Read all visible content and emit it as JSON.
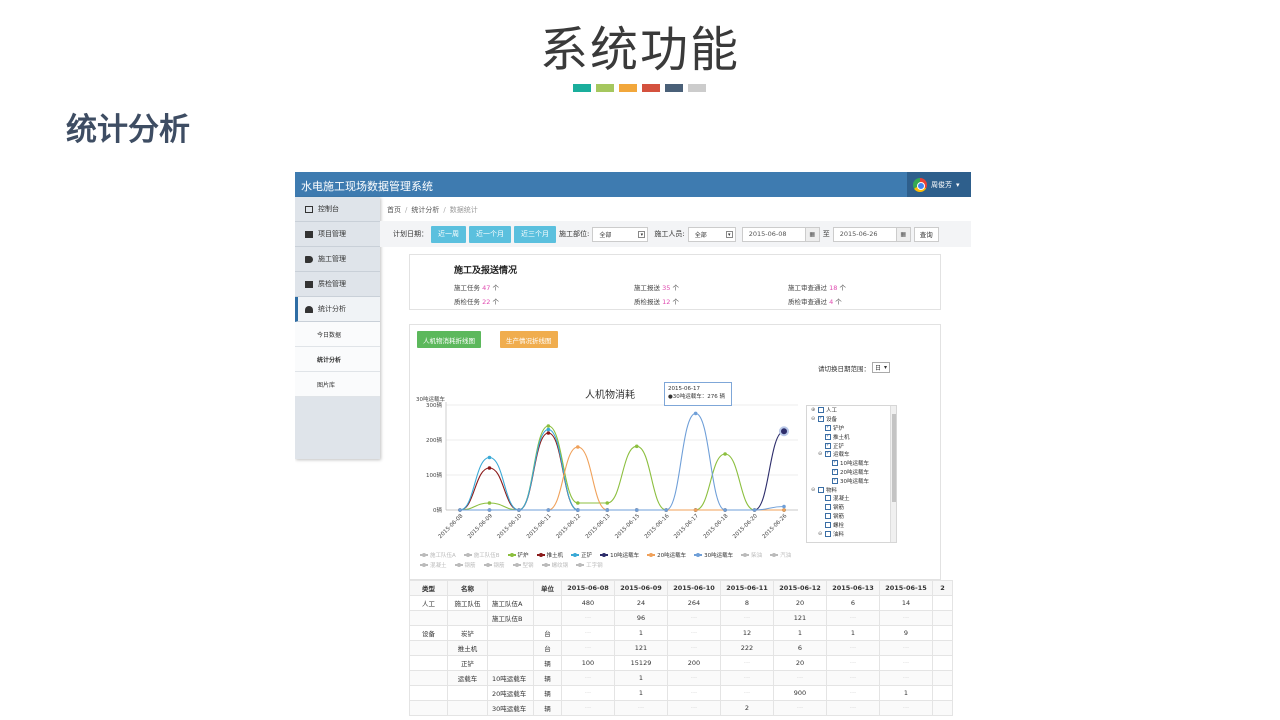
{
  "slide": {
    "title": "系统功能",
    "section": "统计分析",
    "strip_colors": [
      "#1aae9c",
      "#a5c75e",
      "#f2a73b",
      "#d4513e",
      "#4a6078",
      "#cccccc"
    ]
  },
  "app": {
    "title": "水电施工现场数据管理系统",
    "user": "周俊芳"
  },
  "sidebar": {
    "items": [
      {
        "label": "控制台",
        "icon": "monitor-icon"
      },
      {
        "label": "项目管理",
        "icon": "binoculars-icon"
      },
      {
        "label": "施工管理",
        "icon": "tag-icon"
      },
      {
        "label": "质检管理",
        "icon": "folder-icon"
      },
      {
        "label": "统计分析",
        "icon": "dashboard-icon"
      }
    ],
    "sub_items": [
      {
        "label": "今日数据"
      },
      {
        "label": "统计分析"
      },
      {
        "label": "图片库"
      }
    ]
  },
  "breadcrumb": {
    "home": "首页",
    "parent": "统计分析",
    "current": "数据统计"
  },
  "filter": {
    "plan_date_label": "计划日期：",
    "btn_week": "近一周",
    "btn_month": "近一个月",
    "btn_quarter": "近三个月",
    "dept_label": "施工部位:",
    "dept_value": "全部",
    "staff_label": "施工人员:",
    "staff_value": "全部",
    "date_from": "2015-06-08",
    "to_label": "至",
    "date_to": "2015-06-26",
    "query_btn": "查询"
  },
  "summary": {
    "title": "施工及报送情况",
    "stats": [
      {
        "label": "施工任务",
        "value": "47",
        "unit": "个"
      },
      {
        "label": "施工报送",
        "value": "35",
        "unit": "个"
      },
      {
        "label": "施工审查通过",
        "value": "18",
        "unit": "个"
      },
      {
        "label": "质检任务",
        "value": "22",
        "unit": "个"
      },
      {
        "label": "质检报送",
        "value": "12",
        "unit": "个"
      },
      {
        "label": "质检审查通过",
        "value": "4",
        "unit": "个"
      }
    ]
  },
  "chart_panel": {
    "tab1": "人机物消耗折线图",
    "tab2": "生产情况折线图",
    "range_label": "请切换日期范围：",
    "range_value": "日",
    "tooltip_date": "2015-06-17",
    "tooltip_text": "●30吨运载车：276 辆",
    "tree": [
      {
        "label": "人工",
        "level": 0,
        "toggle": "⊕",
        "checked": false
      },
      {
        "label": "设备",
        "level": 0,
        "toggle": "⊖",
        "checked": true
      },
      {
        "label": "铲炉",
        "level": 1,
        "toggle": "",
        "checked": true
      },
      {
        "label": "推土机",
        "level": 1,
        "toggle": "",
        "checked": true
      },
      {
        "label": "正铲",
        "level": 1,
        "toggle": "",
        "checked": true
      },
      {
        "label": "运载车",
        "level": 1,
        "toggle": "⊖",
        "checked": true
      },
      {
        "label": "10吨运载车",
        "level": 2,
        "toggle": "",
        "checked": true
      },
      {
        "label": "20吨运载车",
        "level": 2,
        "toggle": "",
        "checked": true
      },
      {
        "label": "30吨运载车",
        "level": 2,
        "toggle": "",
        "checked": true
      },
      {
        "label": "物料",
        "level": 0,
        "toggle": "⊖",
        "checked": false
      },
      {
        "label": "混凝土",
        "level": 1,
        "toggle": "",
        "checked": false
      },
      {
        "label": "钢筋",
        "level": 1,
        "toggle": "",
        "checked": false
      },
      {
        "label": "钢筋",
        "level": 1,
        "toggle": "",
        "checked": false
      },
      {
        "label": "螺栓",
        "level": 1,
        "toggle": "",
        "checked": false
      },
      {
        "label": "油料",
        "level": 1,
        "toggle": "⊖",
        "checked": false
      }
    ],
    "legend": [
      {
        "name": "施工队伍A",
        "color": "#bbbbbb",
        "on": false
      },
      {
        "name": "施工队伍B",
        "color": "#bbbbbb",
        "on": false
      },
      {
        "name": "铲炉",
        "color": "#8cbf3f",
        "on": true
      },
      {
        "name": "推土机",
        "color": "#8b1a1a",
        "on": true
      },
      {
        "name": "正铲",
        "color": "#3aa9d6",
        "on": true
      },
      {
        "name": "10吨运载车",
        "color": "#2d2d6b",
        "on": true
      },
      {
        "name": "20吨运载车",
        "color": "#f0a15a",
        "on": true
      },
      {
        "name": "30吨运载车",
        "color": "#6f9fd8",
        "on": true
      },
      {
        "name": "柴油",
        "color": "#bbbbbb",
        "on": false
      },
      {
        "name": "汽油",
        "color": "#bbbbbb",
        "on": false
      },
      {
        "name": "混凝土",
        "color": "#bbbbbb",
        "on": false
      },
      {
        "name": "钢筋",
        "color": "#bbbbbb",
        "on": false
      },
      {
        "name": "钢筋",
        "color": "#bbbbbb",
        "on": false
      },
      {
        "name": "型钢",
        "color": "#bbbbbb",
        "on": false
      },
      {
        "name": "螺纹钢",
        "color": "#bbbbbb",
        "on": false
      },
      {
        "name": "工字钢",
        "color": "#bbbbbb",
        "on": false
      }
    ]
  },
  "chart_data": {
    "type": "line",
    "title": "人机物消耗",
    "ylabel": "30吨运载车",
    "y_ticks": [
      "0辆",
      "100辆",
      "200辆",
      "300辆"
    ],
    "ylim": [
      0,
      300
    ],
    "categories": [
      "2015-06-08",
      "2015-06-09",
      "2015-06-10",
      "2015-06-11",
      "2015-06-12",
      "2015-06-13",
      "2015-06-15",
      "2015-06-16",
      "2015-06-17",
      "2015-06-18",
      "2015-06-20",
      "2015-06-26"
    ],
    "series": [
      {
        "name": "铲炉",
        "color": "#8cbf3f",
        "values": [
          0,
          20,
          0,
          240,
          20,
          20,
          182,
          0,
          0,
          160,
          0,
          0
        ]
      },
      {
        "name": "推土机",
        "color": "#8b1a1a",
        "values": [
          0,
          120,
          0,
          220,
          0,
          0,
          0,
          0,
          0,
          0,
          0,
          0
        ]
      },
      {
        "name": "正铲",
        "color": "#3aa9d6",
        "values": [
          0,
          150,
          0,
          230,
          0,
          0,
          0,
          0,
          0,
          0,
          0,
          0
        ]
      },
      {
        "name": "10吨运载车",
        "color": "#2d2d6b",
        "values": [
          0,
          0,
          0,
          0,
          0,
          0,
          0,
          0,
          0,
          0,
          0,
          225
        ]
      },
      {
        "name": "20吨运载车",
        "color": "#f0a15a",
        "values": [
          0,
          0,
          0,
          0,
          180,
          0,
          0,
          0,
          0,
          0,
          0,
          0
        ]
      },
      {
        "name": "30吨运载车",
        "color": "#6f9fd8",
        "values": [
          0,
          0,
          0,
          0,
          0,
          0,
          0,
          0,
          276,
          0,
          0,
          10
        ]
      }
    ]
  },
  "table": {
    "headers": [
      "类型",
      "名称",
      "",
      "单位",
      "2015-06-08",
      "2015-06-09",
      "2015-06-10",
      "2015-06-11",
      "2015-06-12",
      "2015-06-13",
      "2015-06-15",
      "2"
    ],
    "rows": [
      [
        "人工",
        "施工队伍",
        "施工队伍A",
        "",
        "480",
        "24",
        "264",
        "8",
        "20",
        "6",
        "14",
        ""
      ],
      [
        "",
        "",
        "施工队伍B",
        "",
        "···",
        "96",
        "···",
        "···",
        "121",
        "···",
        "···",
        ""
      ],
      [
        "设备",
        "炭铲",
        "",
        "台",
        "···",
        "1",
        "···",
        "12",
        "1",
        "1",
        "9",
        ""
      ],
      [
        "",
        "推土机",
        "",
        "台",
        "···",
        "121",
        "···",
        "222",
        "6",
        "···",
        "···",
        ""
      ],
      [
        "",
        "正铲",
        "",
        "辆",
        "100",
        "15129",
        "200",
        "···",
        "20",
        "···",
        "···",
        ""
      ],
      [
        "",
        "运载车",
        "10吨运载车",
        "辆",
        "···",
        "1",
        "···",
        "···",
        "···",
        "···",
        "···",
        ""
      ],
      [
        "",
        "",
        "20吨运载车",
        "辆",
        "···",
        "1",
        "···",
        "···",
        "900",
        "···",
        "1",
        ""
      ],
      [
        "",
        "",
        "30吨运载车",
        "辆",
        "···",
        "···",
        "···",
        "2",
        "···",
        "···",
        "···",
        ""
      ]
    ]
  }
}
